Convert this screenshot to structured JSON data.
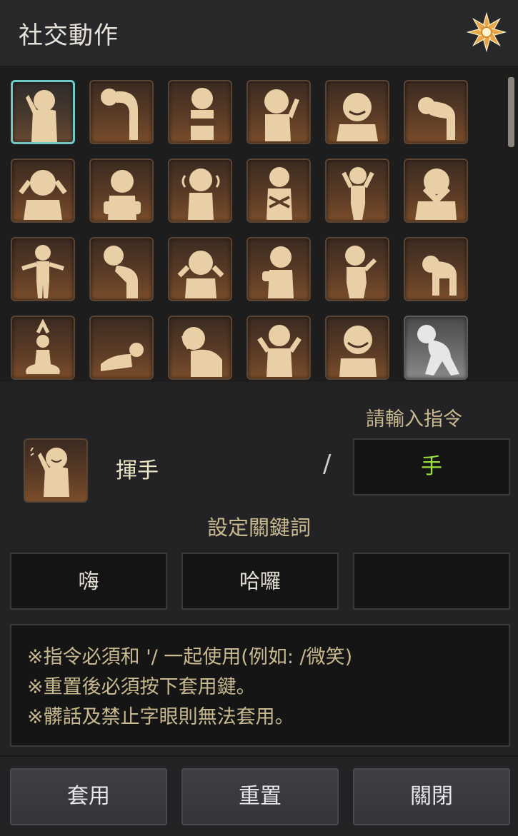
{
  "window": {
    "title": "社交動作",
    "corner_icon": "flower-emblem-icon"
  },
  "emotes": [
    {
      "icon": "wave-emote-icon",
      "selected": true
    },
    {
      "icon": "bow-emote-icon"
    },
    {
      "icon": "fold-arms-emote-icon"
    },
    {
      "icon": "head-scratch-emote-icon"
    },
    {
      "icon": "angry-emote-icon"
    },
    {
      "icon": "cry-emote-icon"
    },
    {
      "icon": "despair-emote-icon"
    },
    {
      "icon": "surprise-emote-icon"
    },
    {
      "icon": "cover-ears-emote-icon"
    },
    {
      "icon": "shiver-emote-icon"
    },
    {
      "icon": "frustrated-emote-icon"
    },
    {
      "icon": "cover-face-emote-icon"
    },
    {
      "icon": "stand-emote-icon"
    },
    {
      "icon": "deep-bow-emote-icon"
    },
    {
      "icon": "shocked-emote-icon"
    },
    {
      "icon": "thumbs-up-emote-icon"
    },
    {
      "icon": "point-emote-icon"
    },
    {
      "icon": "kneel-emote-icon"
    },
    {
      "icon": "meditate-emote-icon"
    },
    {
      "icon": "lie-down-emote-icon"
    },
    {
      "icon": "facepalm-emote-icon"
    },
    {
      "icon": "cheer-emote-icon"
    },
    {
      "icon": "laugh-emote-icon"
    },
    {
      "icon": "crouch-emote-icon",
      "locked": true
    }
  ],
  "command": {
    "label": "請輸入指令",
    "emote_name": "揮手",
    "separator": "/",
    "value": "手",
    "preview_icon": "wave-emote-icon"
  },
  "keywords": {
    "label": "設定關鍵詞",
    "values": [
      "嗨",
      "哈囉",
      ""
    ]
  },
  "notice": [
    "※指令必須和 '/ 一起使用(例如: /微笑)",
    "※重置後必須按下套用鍵。",
    "※髒話及禁止字眼則無法套用。"
  ],
  "buttons": {
    "apply": "套用",
    "reset": "重置",
    "close": "關閉"
  },
  "colors": {
    "accent_selected": "#6ec9c4",
    "command_text": "#9be03c",
    "label_gold": "#c9b98f",
    "figure": "#e8cfa6"
  }
}
